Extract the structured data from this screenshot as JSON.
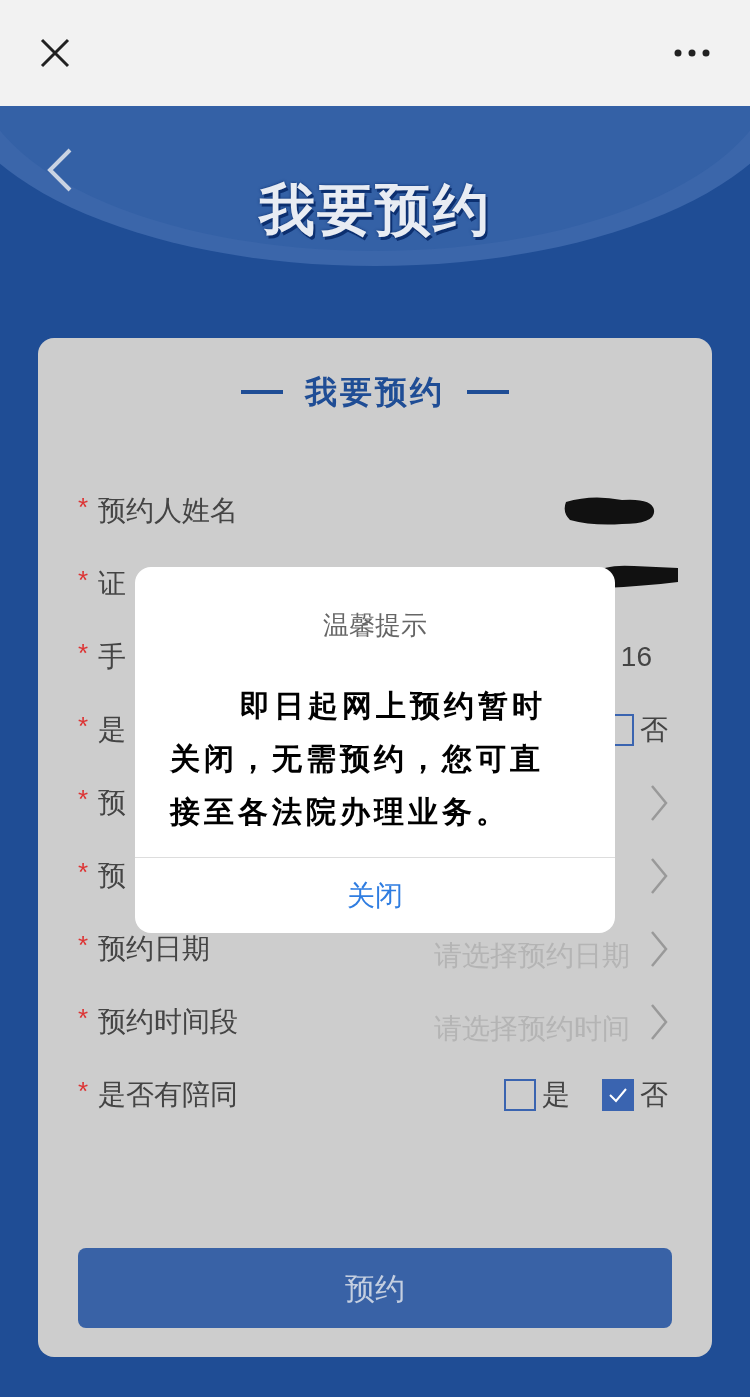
{
  "header": {
    "title": "我要预约"
  },
  "form": {
    "title": "我要预约",
    "rows": [
      {
        "kind": "redacted",
        "mark": "*",
        "label": "预约人姓名"
      },
      {
        "kind": "redacted",
        "mark": "*",
        "label": "证"
      },
      {
        "kind": "value",
        "mark": "*",
        "label": "手",
        "value": "16"
      },
      {
        "kind": "choice",
        "mark": "*",
        "label": "是",
        "options": [
          {
            "label": "否",
            "checked": false
          }
        ]
      },
      {
        "kind": "select",
        "mark": "*",
        "label": "预"
      },
      {
        "kind": "select",
        "mark": "*",
        "label": "预"
      },
      {
        "kind": "select",
        "mark": "*",
        "label": "预约日期",
        "placeholder": "请选择预约日期"
      },
      {
        "kind": "select",
        "mark": "*",
        "label": "预约时间段",
        "placeholder": "请选择预约时间"
      },
      {
        "kind": "choice",
        "mark": "*",
        "label": "是否有陪同",
        "options": [
          {
            "label": "是",
            "checked": false
          },
          {
            "label": "否",
            "checked": true
          }
        ]
      }
    ],
    "submit": "预约"
  },
  "dialog": {
    "title": "温馨提示",
    "message": "即日起网上预约暂时关闭，无需预约，您可直接至各法院办理业务。",
    "button": "关闭"
  }
}
